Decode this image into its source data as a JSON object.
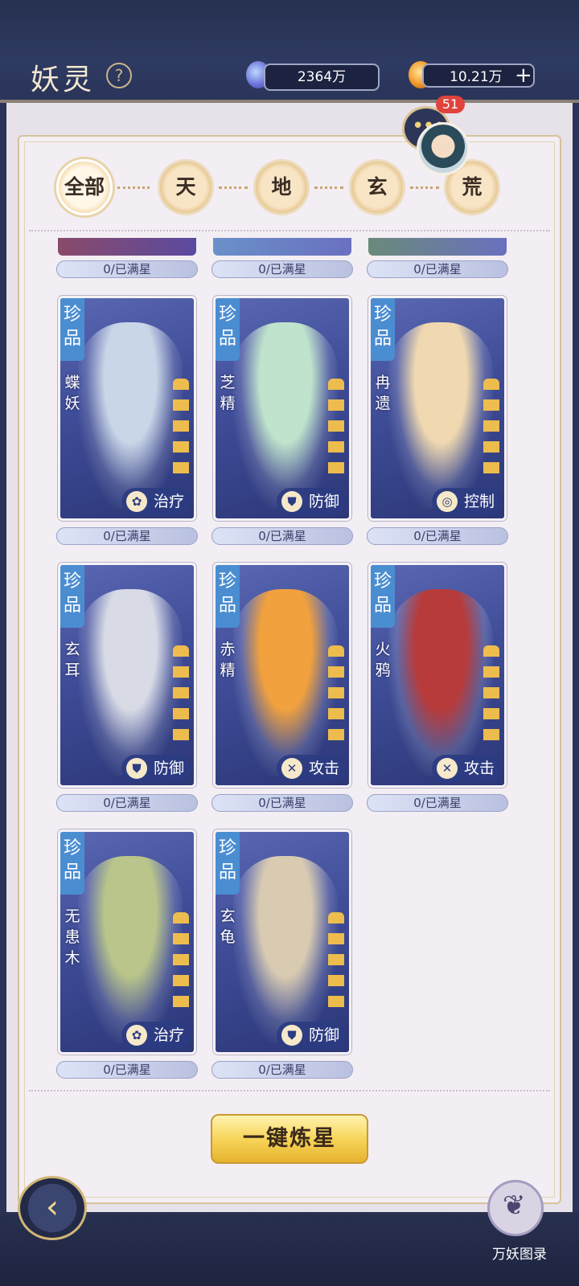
{
  "header": {
    "title": "妖灵",
    "help_icon": "?"
  },
  "resources": [
    {
      "icon": "blue-crystal-icon",
      "value": "2364万"
    },
    {
      "icon": "flame-coin-icon",
      "value": "10.21万",
      "add_icon": "+"
    }
  ],
  "chat": {
    "badge": "51",
    "icon": "chat-bubble-icon"
  },
  "tabs": [
    "全部",
    "天",
    "地",
    "玄",
    "荒"
  ],
  "active_tab": "全部",
  "top_partial_progress": [
    "0/已满星",
    "0/已满星",
    "0/已满星"
  ],
  "cards": [
    {
      "grade": "珍品",
      "name": "蝶妖",
      "role": "治疗",
      "role_icon": "lotus-icon",
      "progress": "0/已满星"
    },
    {
      "grade": "珍品",
      "name": "芝精",
      "role": "防御",
      "role_icon": "shield-icon",
      "progress": "0/已满星"
    },
    {
      "grade": "珍品",
      "name": "冉遗",
      "role": "控制",
      "role_icon": "swirl-icon",
      "progress": "0/已满星"
    },
    {
      "grade": "珍品",
      "name": "玄耳",
      "role": "防御",
      "role_icon": "shield-icon",
      "progress": "0/已满星"
    },
    {
      "grade": "珍品",
      "name": "赤精",
      "role": "攻击",
      "role_icon": "crossed-swords-icon",
      "progress": "0/已满星"
    },
    {
      "grade": "珍品",
      "name": "火鸦",
      "role": "攻击",
      "role_icon": "crossed-swords-icon",
      "progress": "0/已满星"
    },
    {
      "grade": "珍品",
      "name": "无患木",
      "role": "治疗",
      "role_icon": "lotus-icon",
      "progress": "0/已满星"
    },
    {
      "grade": "珍品",
      "name": "玄龟",
      "role": "防御",
      "role_icon": "shield-icon",
      "progress": "0/已满星"
    }
  ],
  "actions": {
    "one_key_star": "一键炼星"
  },
  "bottom": {
    "codex_label": "万妖图录",
    "back_icon": "back-arrow-icon"
  },
  "colors": {
    "accent_gold": "#d6c29a",
    "panel_bg": "#f3eef3",
    "card_blue": "#3f4c97",
    "grade_tag": "#4b8dd1"
  }
}
